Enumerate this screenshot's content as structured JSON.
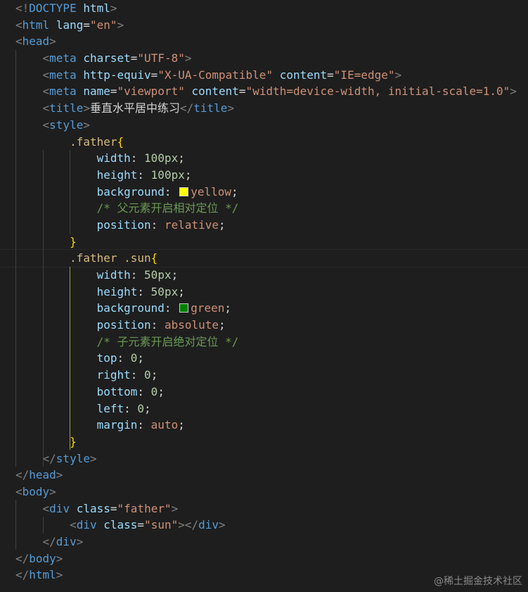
{
  "editor": {
    "background": "#1e1e1e",
    "theme_colors": {
      "tag": "#569cd6",
      "attribute": "#9cdcfe",
      "string": "#ce9178",
      "selector": "#d7ba7d",
      "number": "#b5cea8",
      "comment": "#6a9955",
      "punctuation": "#808080",
      "brace": "#ffd700"
    },
    "lines": [
      {
        "l1a": "<!",
        "l1b": "DOCTYPE",
        "l1c": " html",
        "l1d": ">"
      },
      {},
      {},
      {},
      {},
      {},
      {}
    ],
    "watermark": "@稀土掘金技术社区"
  },
  "code": {
    "doctype_open": "<!",
    "doctype_kw": "DOCTYPE",
    "doctype_html": "html",
    "gt": ">",
    "lt": "<",
    "lt_slash": "</",
    "html": "html",
    "lang_attr": "lang",
    "eq": "=",
    "lang_val": "\"en\"",
    "head": "head",
    "meta": "meta",
    "charset_attr": "charset",
    "charset_val": "\"UTF-8\"",
    "http_equiv_attr": "http-equiv",
    "http_equiv_val": "\"X-UA-Compatible\"",
    "content_attr": "content",
    "content_val_ie": "\"IE=edge\"",
    "name_attr": "name",
    "name_val": "\"viewport\"",
    "content_val_vp": "\"width=device-width, initial-scale=1.0\"",
    "title": "title",
    "title_text": "垂直水平居中练习",
    "style": "style",
    "sel_father": ".father",
    "sel_father_sun": ".father .sun",
    "brace_open": "{",
    "brace_close": "}",
    "p_width": "width",
    "p_height": "height",
    "p_background": "background",
    "p_position": "position",
    "p_top": "top",
    "p_right": "right",
    "p_bottom": "bottom",
    "p_left": "left",
    "p_margin": "margin",
    "colon": ":",
    "semi": ";",
    "v_100px": "100px",
    "v_50px": "50px",
    "v_yellow": "yellow",
    "v_green": "green",
    "v_relative": "relative",
    "v_absolute": "absolute",
    "v_0": "0",
    "v_auto": "auto",
    "comment_father": "/* 父元素开启相对定位 */",
    "comment_sun": "/* 子元素开启绝对定位 */",
    "body": "body",
    "div": "div",
    "class_attr": "class",
    "class_father_val": "\"father\"",
    "class_sun_val": "\"sun\"",
    "swatch_yellow": "#ffff00",
    "swatch_green": "#008000"
  }
}
